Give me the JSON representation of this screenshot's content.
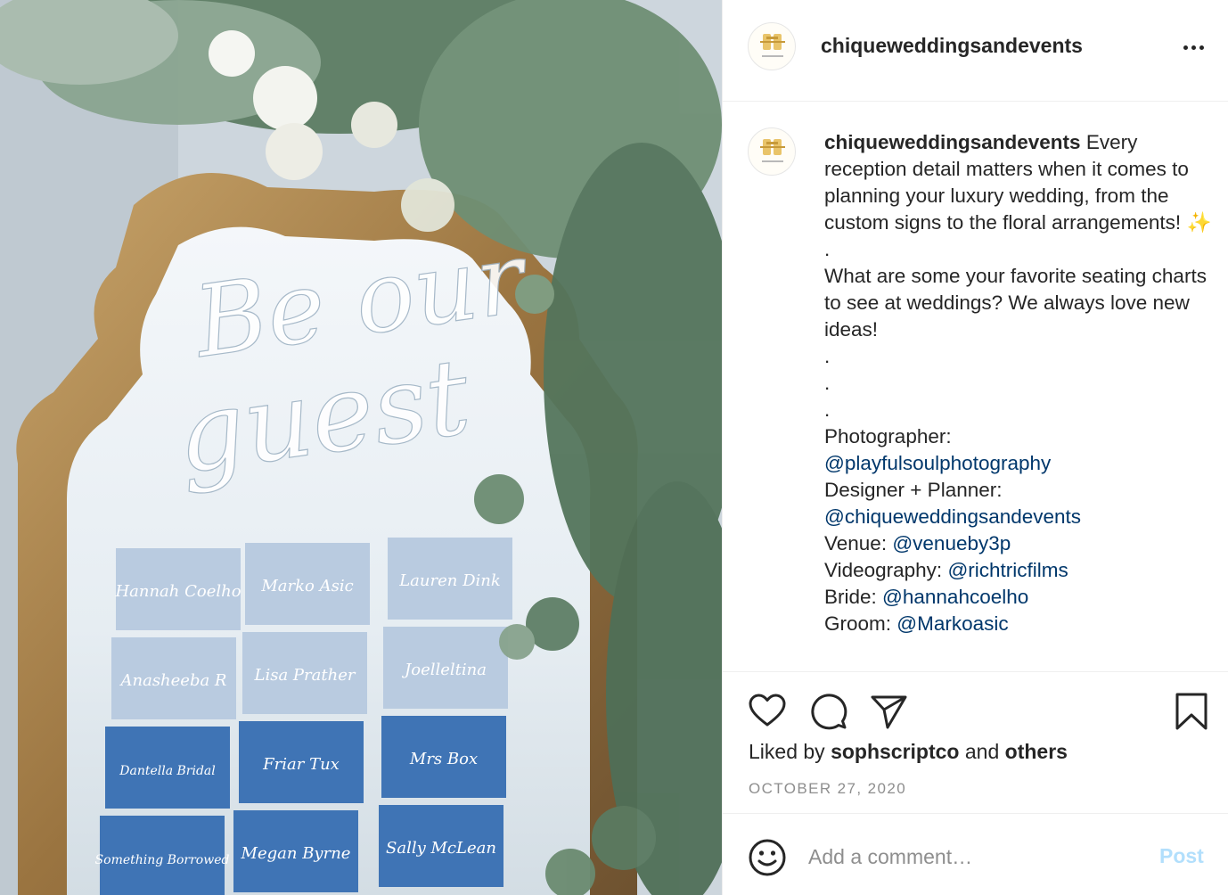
{
  "post": {
    "username": "chiqueweddingsandevents",
    "photo_caption_art": {
      "sign_line1": "Be our",
      "sign_line2": "guest",
      "cards": [
        "Hannah Coelho",
        "Marko Asic",
        "Lauren Dink",
        "Anasheeba R",
        "Lisa Prather",
        "Joelleltina",
        "Dantella Bridal",
        "Friar Tux",
        "Mrs Box",
        "Something Borrowed",
        "Megan Byrne",
        "Sally McLean"
      ]
    },
    "caption": {
      "username": "chiqueweddingsandevents",
      "first_text": " Every reception detail matters when it comes to planning your luxury wedding, from the custom signs to the floral arrangements! ",
      "sparkles": "✨",
      "dot": ".",
      "question": "What are some your favorite seating charts to see at weddings? We always love new ideas!",
      "photographer_label": "Photographer:",
      "photographer_handle": "@playfulsoulphotography",
      "designer_label": "Designer + Planner:",
      "designer_handle": "@chiqueweddingsandevents",
      "venue_label": "Venue: ",
      "venue_handle": "@venueby3p",
      "video_label": "Videography: ",
      "video_handle": "@richtricfilms",
      "bride_label": "Bride: ",
      "bride_handle": "@hannahcoelho",
      "groom_label": "Groom: ",
      "groom_handle": "@Markoasic"
    },
    "likes": {
      "prefix": "Liked by ",
      "user": "sophscriptco",
      "middle": " and ",
      "others": "others"
    },
    "date": "OCTOBER 27, 2020",
    "comment": {
      "placeholder": "Add a comment…",
      "post_label": "Post"
    },
    "icons": {
      "more": "more-options-icon",
      "like": "heart-icon",
      "comment": "comment-icon",
      "share": "share-icon",
      "save": "bookmark-icon",
      "emoji": "emoji-icon"
    },
    "colors": {
      "link": "#00376b",
      "post_disabled": "#b2dffc",
      "muted": "#8e8e8e"
    }
  }
}
